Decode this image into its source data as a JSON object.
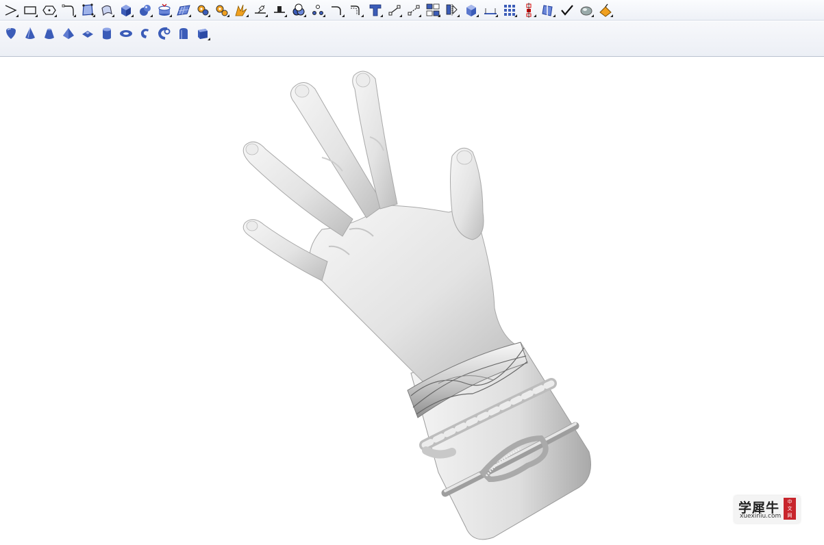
{
  "toolbar_top": {
    "buttons": [
      {
        "name": "polyline-icon"
      },
      {
        "name": "rectangle-icon"
      },
      {
        "name": "polygon-icon"
      },
      {
        "name": "curve-icon"
      },
      {
        "name": "surface-from-points-icon"
      },
      {
        "name": "extrude-surface-icon"
      },
      {
        "name": "box-solid-icon"
      },
      {
        "name": "sphere-solid-icon"
      },
      {
        "name": "cylinder-extrude-icon"
      },
      {
        "name": "planar-surface-icon"
      },
      {
        "name": "boolean-gear-icon"
      },
      {
        "name": "boolean-gear-alt-icon"
      },
      {
        "name": "explode-icon"
      },
      {
        "name": "trim-icon"
      },
      {
        "name": "split-icon"
      },
      {
        "name": "boolean-union-icon"
      },
      {
        "name": "points-icon"
      },
      {
        "name": "fillet-curve-icon"
      },
      {
        "name": "offset-curve-icon"
      },
      {
        "name": "text-icon"
      },
      {
        "name": "move-icon"
      },
      {
        "name": "copy-icon"
      },
      {
        "name": "group-icon"
      },
      {
        "name": "mirror-icon"
      },
      {
        "name": "view-box-icon"
      },
      {
        "name": "dimension-icon"
      },
      {
        "name": "array-grid-icon"
      },
      {
        "name": "align-icon"
      },
      {
        "name": "analyze-icon"
      },
      {
        "name": "check-icon"
      },
      {
        "name": "render-icon"
      },
      {
        "name": "material-bucket-icon"
      }
    ]
  },
  "toolbar_solids": {
    "buttons": [
      {
        "name": "sphere-icon"
      },
      {
        "name": "cone-icon"
      },
      {
        "name": "truncated-cone-icon"
      },
      {
        "name": "pyramid-icon"
      },
      {
        "name": "truncated-pyramid-icon"
      },
      {
        "name": "cylinder-icon"
      },
      {
        "name": "ellipsoid-icon"
      },
      {
        "name": "torus-icon"
      },
      {
        "name": "pipe-icon"
      },
      {
        "name": "tube-icon"
      },
      {
        "name": "box-icon"
      }
    ]
  },
  "watermark": {
    "text_cn": "学犀牛",
    "url": "xuexiniu.com",
    "badge": [
      "中",
      "文",
      "网"
    ]
  },
  "colors": {
    "icon_blue": "#3b5cb8",
    "accent_orange": "#f0a020",
    "viewport_bg": "#ffffff",
    "badge_red": "#c8252c"
  }
}
